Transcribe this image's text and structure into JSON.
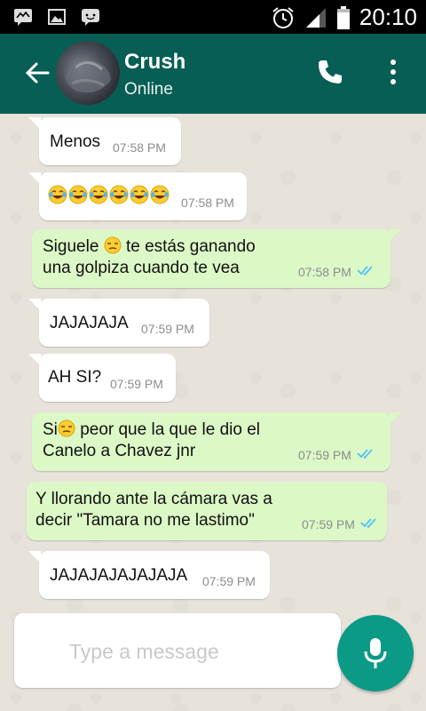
{
  "status_bar": {
    "time": "20:10",
    "icons": [
      "messages-app-icon",
      "gallery-icon",
      "chat-app-icon",
      "alarm-icon",
      "signal-icon",
      "battery-icon"
    ]
  },
  "header": {
    "contact_name": "Crush",
    "contact_status": "Online",
    "icons": [
      "back-arrow-icon",
      "phone-icon",
      "overflow-menu-icon"
    ],
    "color": "#075e54"
  },
  "messages": [
    {
      "direction": "in",
      "text": "Menos",
      "time": "07:58 PM"
    },
    {
      "direction": "in",
      "emoji": [
        "face-with-tears-of-joy",
        "face-with-tears-of-joy",
        "face-with-tears-of-joy",
        "face-with-tears-of-joy",
        "face-with-tears-of-joy",
        "face-with-tears-of-joy"
      ],
      "time": "07:58 PM"
    },
    {
      "direction": "out",
      "line1_a": "Siguele",
      "line1_b": "te estás ganando",
      "line2": "una golpiza cuando te vea",
      "emoji": "unamused-face",
      "time": "07:58 PM",
      "status": "read"
    },
    {
      "direction": "in",
      "text": "JAJAJAJA",
      "time": "07:59 PM"
    },
    {
      "direction": "in",
      "text": "AH SI?",
      "time": "07:59 PM"
    },
    {
      "direction": "out",
      "line1_a": "Si",
      "line1_b": "peor que la que le dio el",
      "line2": "Canelo a Chavez jnr",
      "emoji": "unamused-face",
      "time": "07:59 PM",
      "status": "read"
    },
    {
      "direction": "out",
      "line1": "Y llorando ante la cámara vas a",
      "line2": "decir \"Tamara no me lastimo\"",
      "time": "07:59 PM",
      "status": "read"
    },
    {
      "direction": "in",
      "text": "JAJAJAJAJAJAJA",
      "time": "07:59 PM"
    }
  ],
  "composer": {
    "placeholder": "Type a message",
    "value": "",
    "mic_icon": "microphone-icon",
    "accent": "#0b9a85"
  },
  "colors": {
    "incoming_bubble": "#ffffff",
    "outgoing_bubble": "#dcf8c6",
    "read_ticks": "#4fc3f7",
    "chat_background": "#e7e2da"
  }
}
